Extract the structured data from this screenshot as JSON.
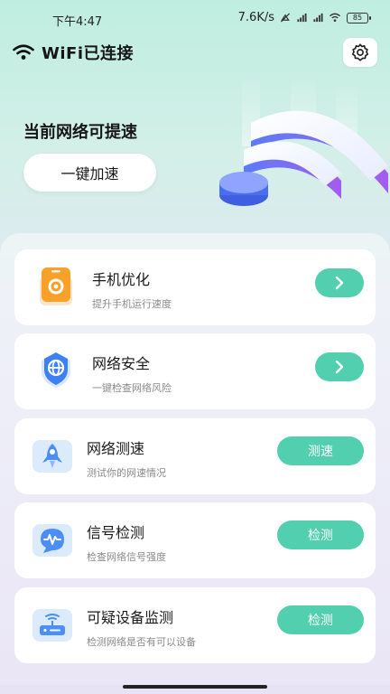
{
  "status": {
    "time": "下午4:47",
    "speed": "7.6K/s",
    "battery": "85"
  },
  "header": {
    "title": "WiFi已连接"
  },
  "hero": {
    "title": "当前网络可提速",
    "button_label": "一键加速"
  },
  "cards": [
    {
      "title": "手机优化",
      "subtitle": "提升手机运行速度",
      "icon": "phone-optimize-icon"
    },
    {
      "title": "网络安全",
      "subtitle": "一键检查网络风险",
      "icon": "network-shield-icon"
    },
    {
      "title": "网络测速",
      "subtitle": "测试你的网速情况",
      "button": "测速",
      "icon": "rocket-icon"
    },
    {
      "title": "信号检测",
      "subtitle": "检查网络信号强度",
      "button": "检测",
      "icon": "signal-bubble-icon"
    },
    {
      "title": "可疑设备监测",
      "subtitle": "检测网络是否有可以设备",
      "button": "检测",
      "icon": "router-icon"
    }
  ],
  "colors": {
    "accent": "#52cfae",
    "card_bg": "#ffffff",
    "wifi_purple": "#8b5cf6"
  }
}
